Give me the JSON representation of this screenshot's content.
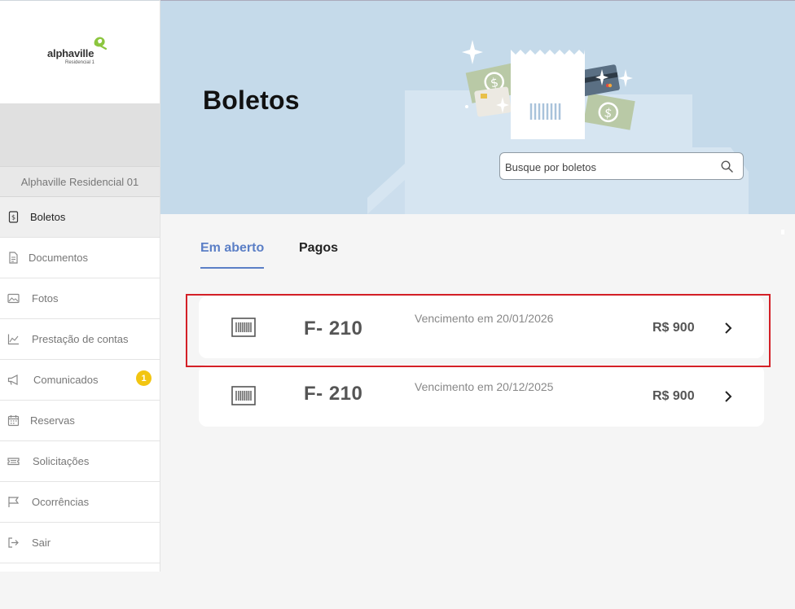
{
  "sidebar": {
    "logo_word": "alphaville",
    "logo_sub": "Residencial 1",
    "condo_name": "Alphaville Residencial 01",
    "items": [
      {
        "label": "Boletos",
        "icon": "boleto-icon",
        "active": true
      },
      {
        "label": "Documentos",
        "icon": "document-icon"
      },
      {
        "label": "Fotos",
        "icon": "photo-icon"
      },
      {
        "label": "Prestação de contas",
        "icon": "chart-icon"
      },
      {
        "label": "Comunicados",
        "icon": "megaphone-icon",
        "badge": "1"
      },
      {
        "label": "Reservas",
        "icon": "calendar-icon"
      },
      {
        "label": "Solicitações",
        "icon": "ticket-icon"
      },
      {
        "label": "Ocorrências",
        "icon": "flag-icon"
      },
      {
        "label": "Sair",
        "icon": "logout-icon"
      }
    ]
  },
  "header": {
    "title": "Boletos",
    "search_placeholder": "Busque por boletos"
  },
  "tabs": {
    "open": "Em aberto",
    "paid": "Pagos"
  },
  "boletos": [
    {
      "unit": "F- 210",
      "due": "Vencimento em 20/01/2026",
      "amount": "R$ 900"
    },
    {
      "unit": "F- 210",
      "due": "Vencimento em 20/12/2025",
      "amount": "R$ 900"
    }
  ],
  "colors": {
    "accent": "#5b7fc6",
    "hero_bg": "#c5daea",
    "badge": "#f2c511",
    "highlight": "#d42027",
    "logo_green": "#8cc63f"
  }
}
